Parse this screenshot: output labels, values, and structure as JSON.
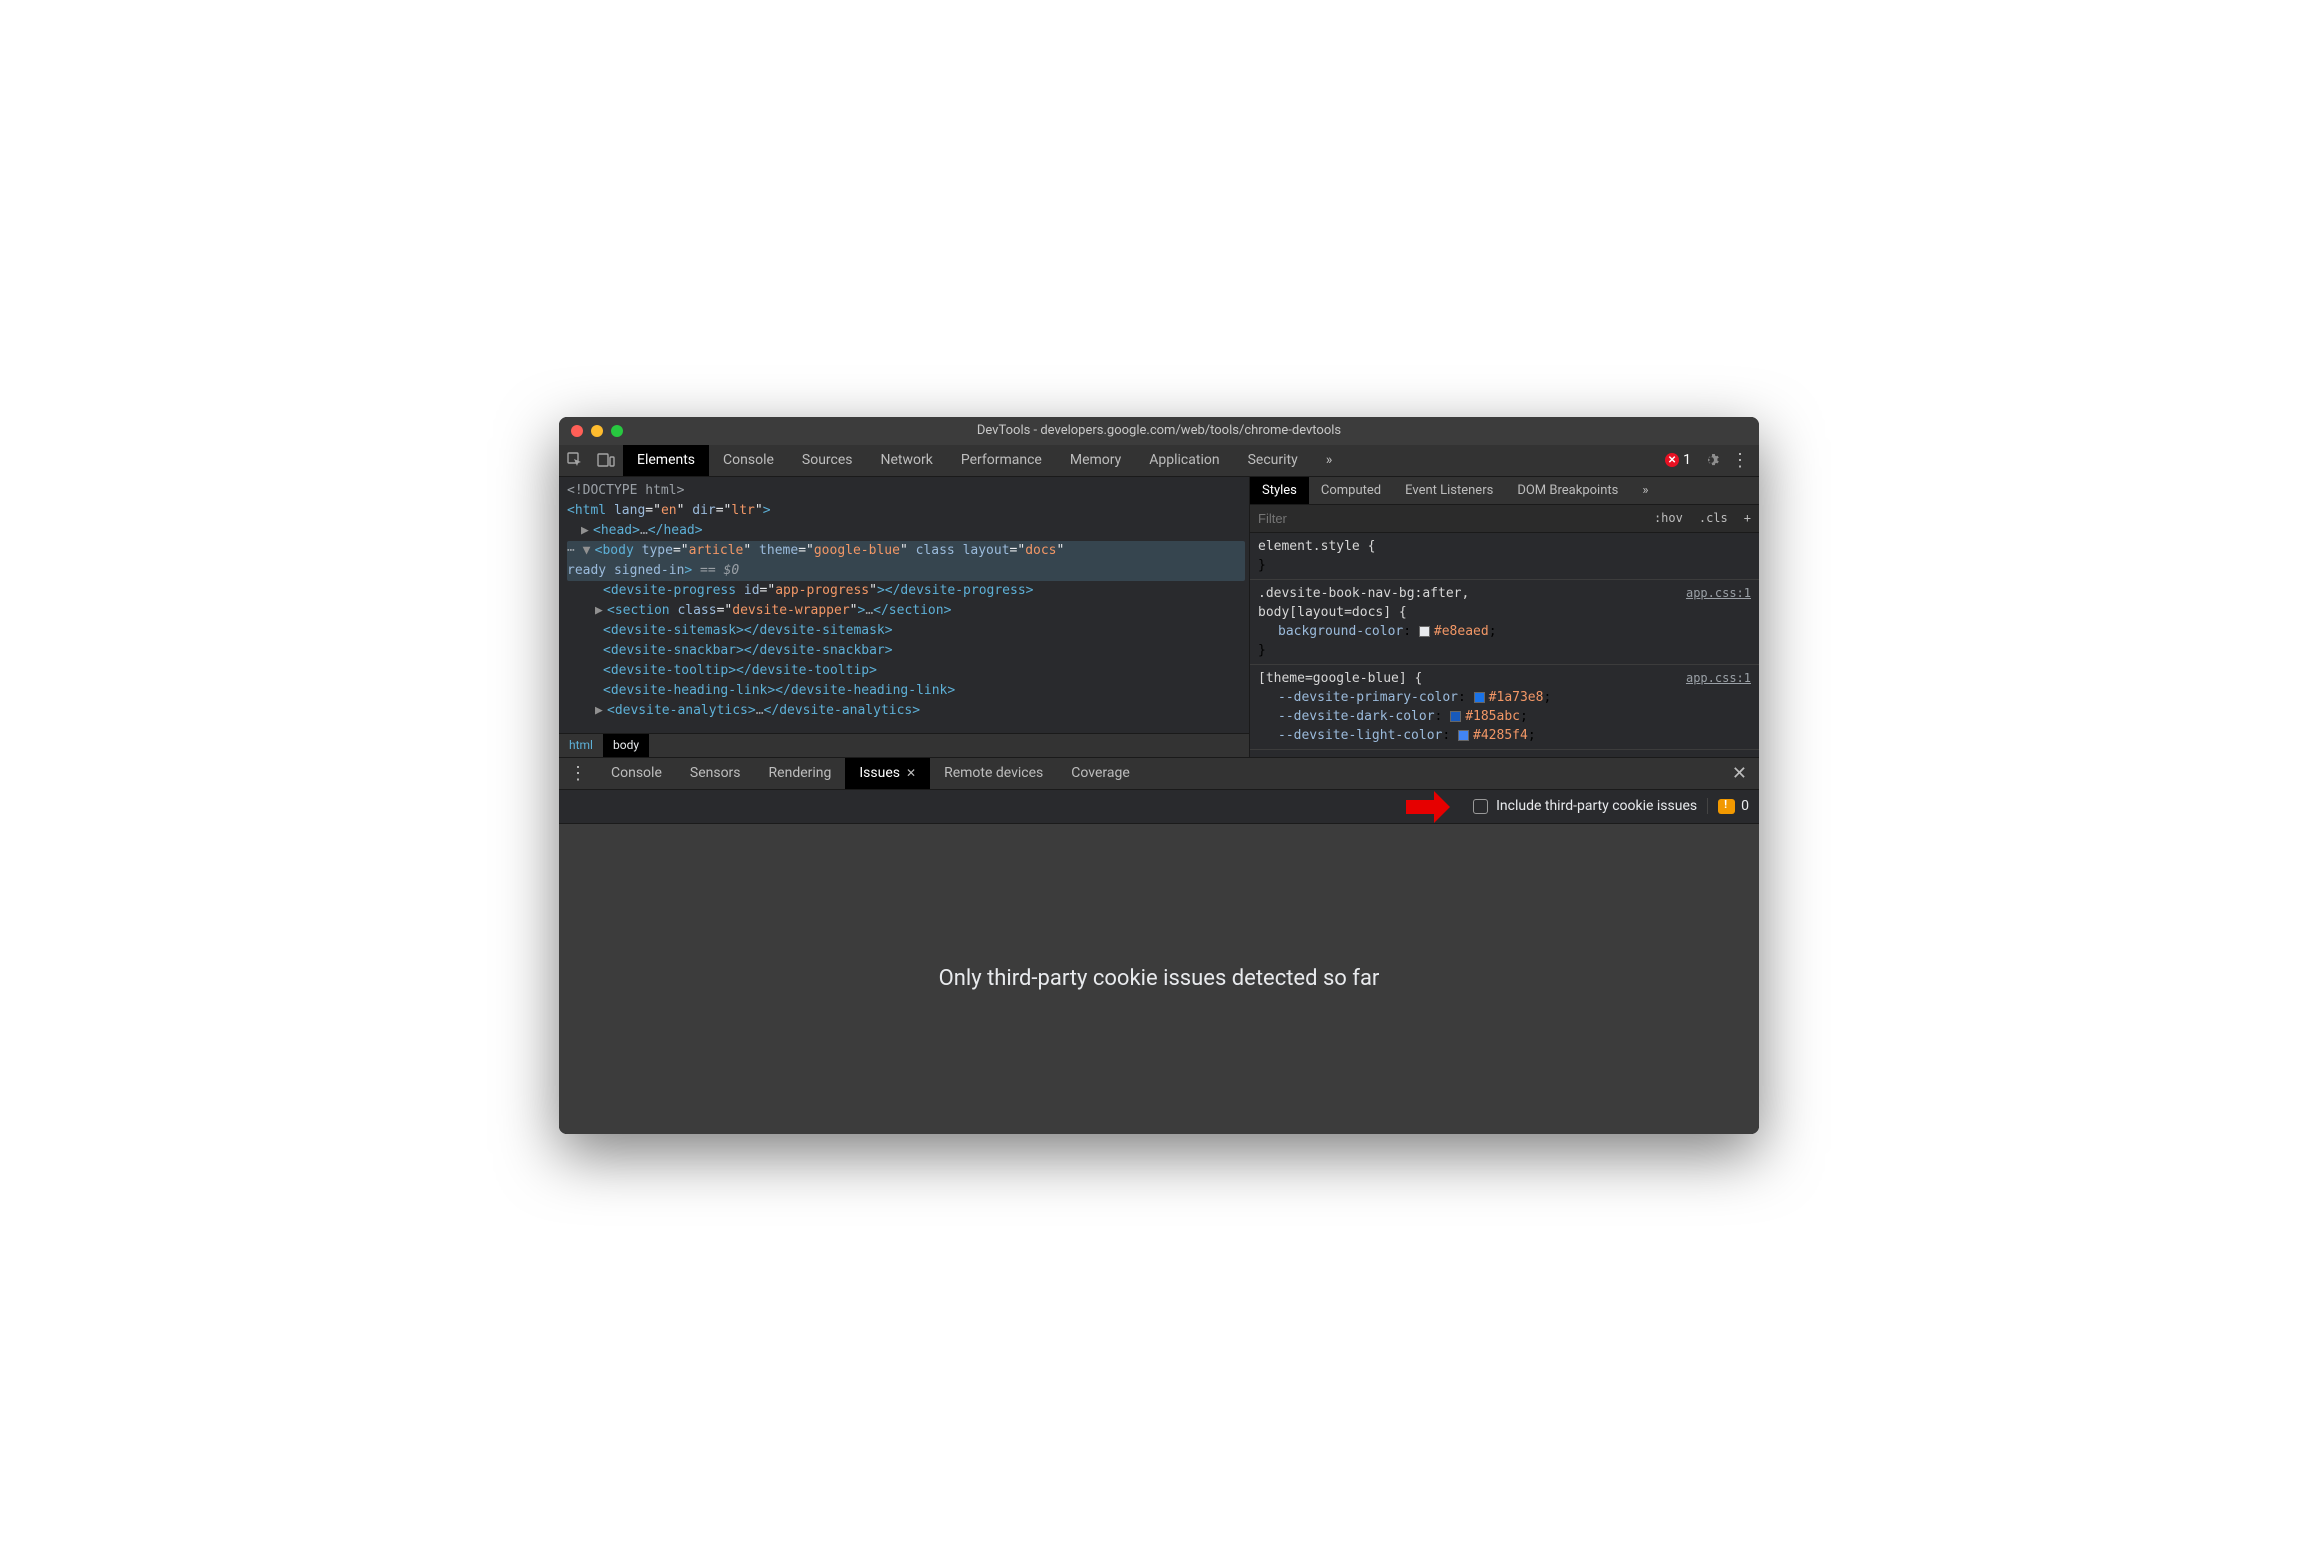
{
  "titlebar": {
    "title": "DevTools - developers.google.com/web/tools/chrome-devtools"
  },
  "toolbar": {
    "tabs": [
      "Elements",
      "Console",
      "Sources",
      "Network",
      "Performance",
      "Memory",
      "Application",
      "Security"
    ],
    "more": "»",
    "error_count": "1"
  },
  "dom": {
    "doctype": "<!DOCTYPE html>",
    "html_open": "<html lang=\"en\" dir=\"ltr\">",
    "head": "<head>…</head>",
    "body_attrs": {
      "type": "article",
      "theme": "google-blue",
      "layout": "docs",
      "classes": "ready signed-in",
      "eq": " == $0"
    },
    "children": [
      "<devsite-progress id=\"app-progress\"></devsite-progress>",
      "<section class=\"devsite-wrapper\">…</section>",
      "<devsite-sitemask></devsite-sitemask>",
      "<devsite-snackbar></devsite-snackbar>",
      "<devsite-tooltip></devsite-tooltip>",
      "<devsite-heading-link></devsite-heading-link>",
      "<devsite-analytics>…</devsite-analytics>"
    ]
  },
  "crumbs": [
    "html",
    "body"
  ],
  "styles": {
    "tabs": [
      "Styles",
      "Computed",
      "Event Listeners",
      "DOM Breakpoints"
    ],
    "more": "»",
    "filter_placeholder": "Filter",
    "hov": ":hov",
    "cls": ".cls",
    "plus": "+",
    "rules": [
      {
        "selector": "element.style {",
        "props": [],
        "close": "}"
      },
      {
        "selector": ".devsite-book-nav-bg:after,\nbody[layout=docs] {",
        "link": "app.css:1",
        "props": [
          {
            "name": "background-color",
            "val": "#e8eaed",
            "swatch": "#e8eaed"
          }
        ],
        "close": "}"
      },
      {
        "selector": "[theme=google-blue] {",
        "link": "app.css:1",
        "props": [
          {
            "name": "--devsite-primary-color",
            "val": "#1a73e8",
            "swatch": "#1a73e8"
          },
          {
            "name": "--devsite-dark-color",
            "val": "#185abc",
            "swatch": "#185abc"
          },
          {
            "name": "--devsite-light-color",
            "val": "#4285f4",
            "swatch": "#4285f4"
          }
        ]
      }
    ]
  },
  "drawer": {
    "tabs": [
      "Console",
      "Sensors",
      "Rendering",
      "Issues",
      "Remote devices",
      "Coverage"
    ],
    "active": "Issues"
  },
  "issues": {
    "checkbox_label": "Include third-party cookie issues",
    "count": "0",
    "empty_msg": "Only third-party cookie issues detected so far"
  }
}
